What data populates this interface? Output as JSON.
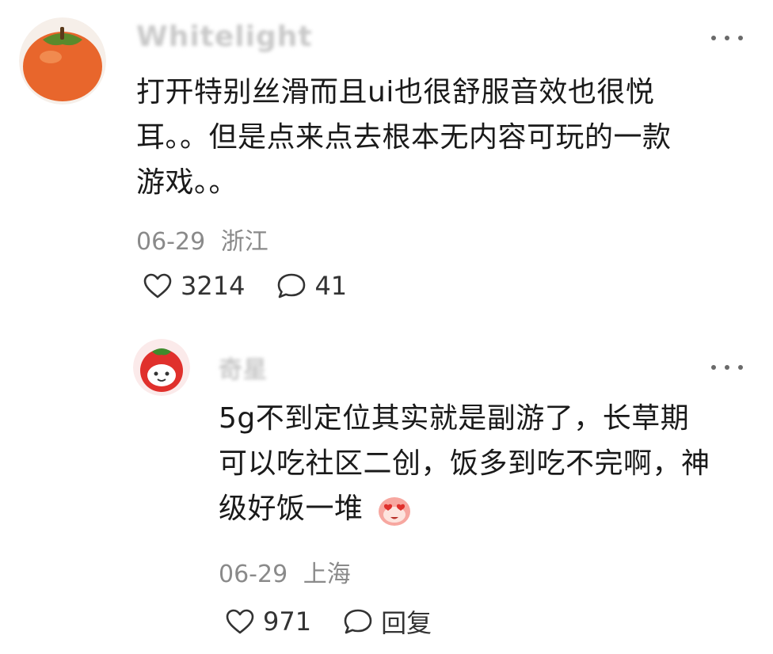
{
  "comment": {
    "username": "Whitelight",
    "avatar": "persimmon-avatar",
    "more_icon": "more-horizontal-icon",
    "text_lines": [
      "打开特别丝滑而且ui也很舒服音效也很悦",
      "耳。。但是点来点去根本无内容可玩的一款",
      "游戏。。"
    ],
    "date": "06-29",
    "location": "浙江",
    "like_icon": "heart-outline-icon",
    "likes": "3214",
    "comment_icon": "speech-bubble-icon",
    "replies": "41"
  },
  "reply": {
    "username": "奇星",
    "avatar": "red-tomato-cartoon-avatar",
    "more_icon": "more-horizontal-icon",
    "text_lines": [
      "5g不到定位其实就是副游了，长草期",
      "可以吃社区二创，饭多到吃不完啊，神",
      "级好饭一堆"
    ],
    "emoji": "heart-eyes-emoji",
    "date": "06-29",
    "location": "上海",
    "like_icon": "heart-outline-icon",
    "likes": "971",
    "reply_icon": "speech-bubble-icon",
    "reply_label": "回复"
  },
  "colors": {
    "text": "#1a1a1a",
    "meta": "#8a8a8a",
    "username_blurred": "#c9c9c9",
    "persimmon": "#e8662c",
    "tomato": "#e0302c"
  }
}
